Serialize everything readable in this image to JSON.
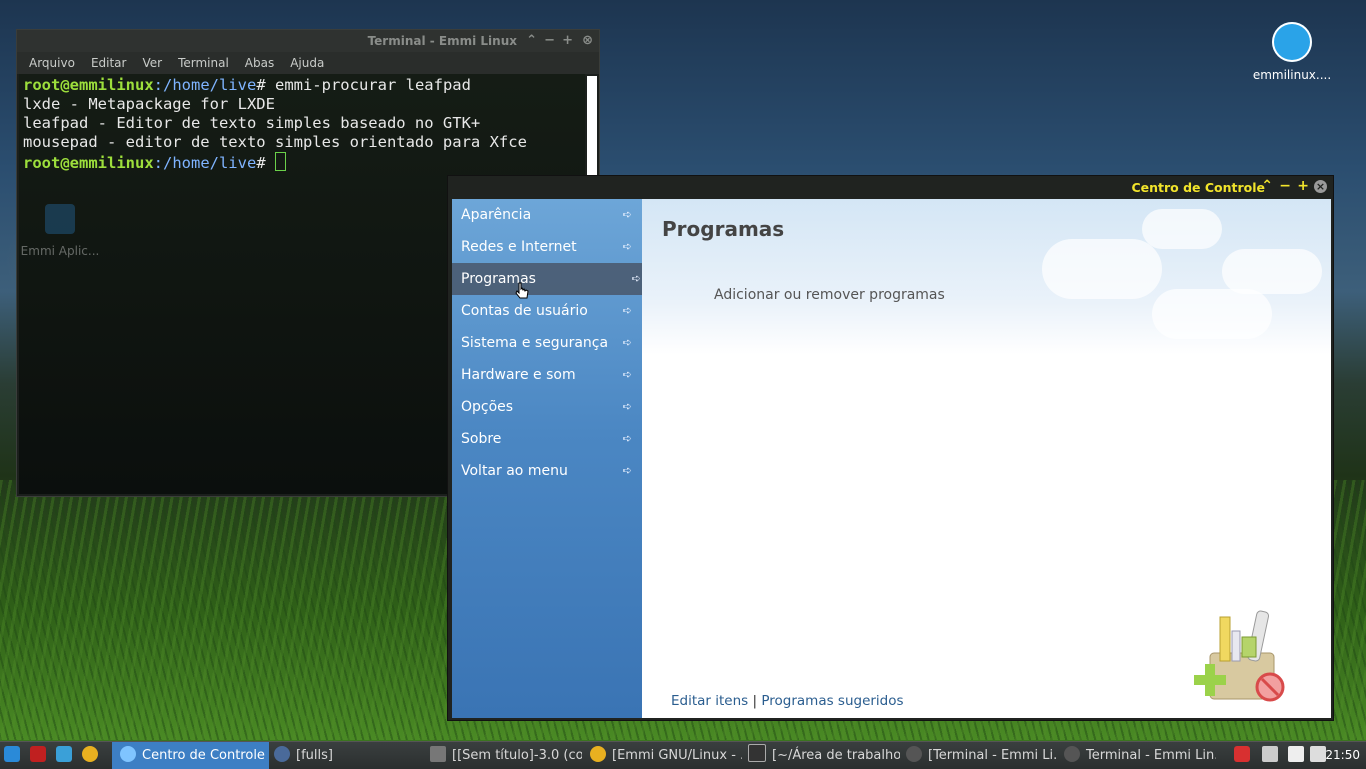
{
  "desktop": {
    "icons": [
      {
        "label": "emmilinux...."
      },
      {
        "label": "Emmi Aplic..."
      }
    ]
  },
  "terminal": {
    "title": "Terminal - Emmi Linux",
    "menu": [
      "Arquivo",
      "Editar",
      "Ver",
      "Terminal",
      "Abas",
      "Ajuda"
    ],
    "prompt_user": "root@emmilinux",
    "prompt_path": ":/home/live",
    "prompt_sym": "# ",
    "command": "emmi-procurar leafpad",
    "output": [
      "lxde - Metapackage for LXDE",
      "leafpad - Editor de texto simples baseado no GTK+",
      "mousepad - editor de texto simples orientado para Xfce"
    ]
  },
  "control_center": {
    "title": "Centro de Controle",
    "sidebar": [
      {
        "label": "Aparência"
      },
      {
        "label": "Redes e Internet"
      },
      {
        "label": "Programas"
      },
      {
        "label": "Contas de usuário"
      },
      {
        "label": "Sistema e segurança"
      },
      {
        "label": "Hardware e som"
      },
      {
        "label": "Opções"
      },
      {
        "label": "Sobre"
      },
      {
        "label": "Voltar ao menu"
      }
    ],
    "active_index": 2,
    "heading": "Programas",
    "action": "Adicionar ou remover programas",
    "footer_left": "Editar itens",
    "footer_sep": "|",
    "footer_right": "Programas sugeridos"
  },
  "taskbar": {
    "items": [
      {
        "label": "Centro de Controle"
      },
      {
        "label": "[fulls]"
      },
      {
        "label": "[[Sem título]-3.0 (co..."
      },
      {
        "label": "[Emmi GNU/Linux - ..."
      },
      {
        "label": "[~/Área de trabalho..."
      },
      {
        "label": "[Terminal - Emmi Li..."
      },
      {
        "label": "Terminal - Emmi Lin..."
      }
    ],
    "clock": "21:50"
  }
}
